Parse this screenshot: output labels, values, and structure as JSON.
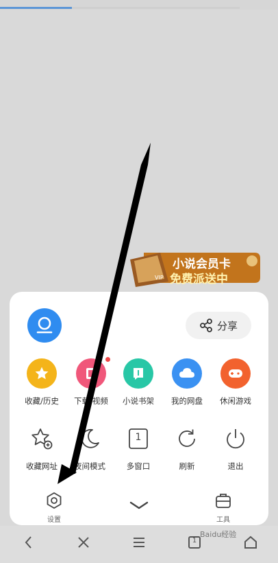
{
  "browser": {
    "share_label": "分享",
    "banner": {
      "line1": "小说会员卡",
      "line2": "免费派送中",
      "tag": "VIP"
    },
    "page_load_progress": 0.3
  },
  "menu_row1": [
    {
      "label": "收藏/历史",
      "icon": "star-icon",
      "color": "#f4b41a"
    },
    {
      "label": "下载/视频",
      "icon": "download-icon",
      "color": "#f0577a"
    },
    {
      "label": "小说书架",
      "icon": "book-icon",
      "color": "#28c7a6"
    },
    {
      "label": "我的网盘",
      "icon": "cloud-icon",
      "color": "#3a91f2"
    },
    {
      "label": "休闲游戏",
      "icon": "gamepad-icon",
      "color": "#f2622e"
    }
  ],
  "menu_row2": [
    {
      "label": "收藏网址",
      "icon": "add-bookmark-icon"
    },
    {
      "label": "夜间模式",
      "icon": "moon-icon"
    },
    {
      "label": "多窗口",
      "icon": "multi-window-icon",
      "count": "1"
    },
    {
      "label": "刷新",
      "icon": "refresh-icon"
    },
    {
      "label": "退出",
      "icon": "power-icon"
    }
  ],
  "menu_row3": {
    "settings_label": "设置",
    "tools_label": "工具"
  },
  "bottom_nav": {
    "tab_count": "1"
  },
  "watermark": "Baidu经验"
}
